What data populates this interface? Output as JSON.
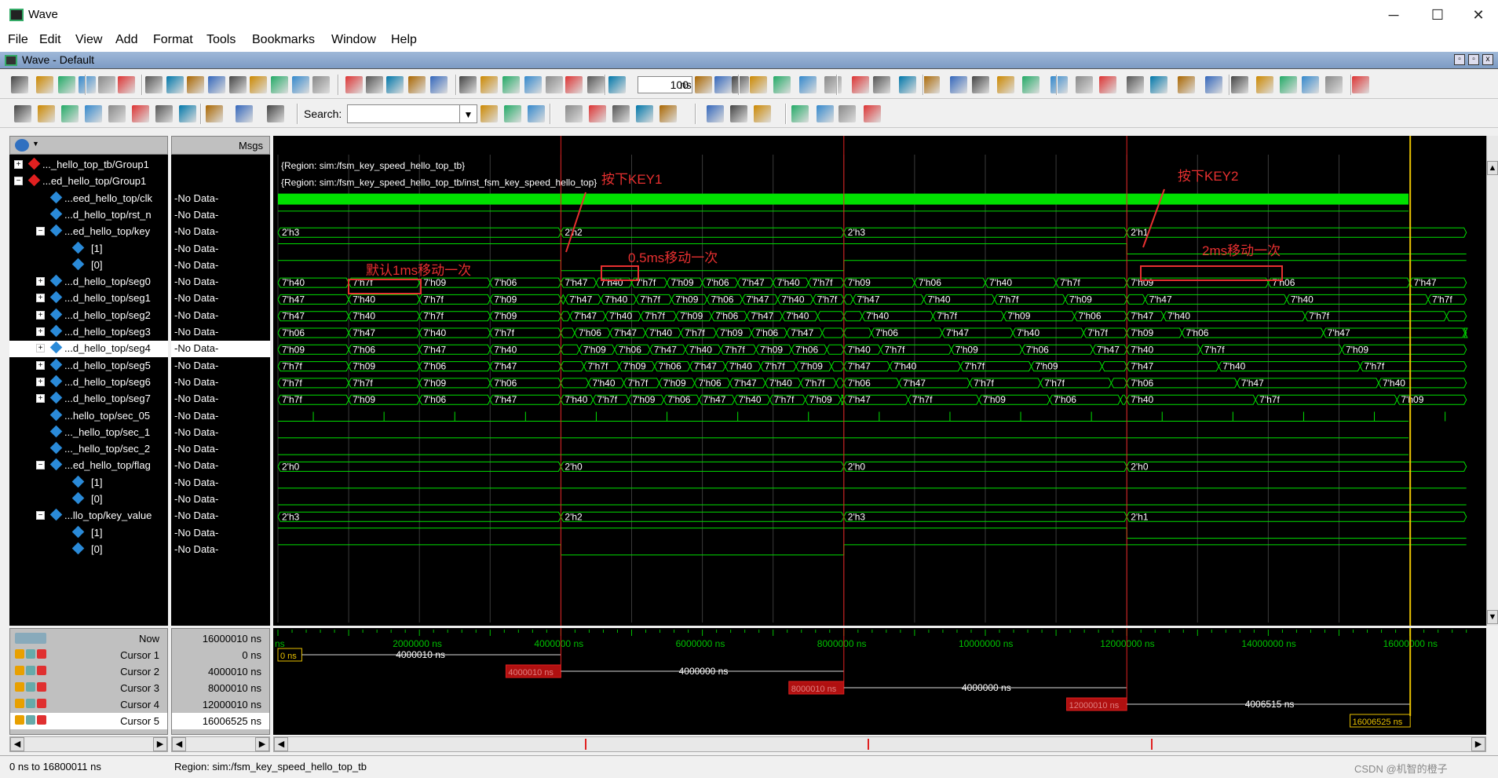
{
  "window": {
    "title": "Wave",
    "minimize": "─",
    "maximize": "☐",
    "close": "✕"
  },
  "menu": [
    "File",
    "Edit",
    "View",
    "Add",
    "Format",
    "Tools",
    "Bookmarks",
    "Window",
    "Help"
  ],
  "pane": {
    "title": "Wave - Default"
  },
  "toolbar": {
    "zoom_value": "100",
    "zoom_unit": "ns",
    "search_label": "Search:",
    "search_value": ""
  },
  "headers": {
    "values": "Msgs"
  },
  "signals": [
    {
      "name": "..._hello_top_tb/Group1",
      "value": "",
      "level": 0,
      "exp": "+",
      "color": "#e02020"
    },
    {
      "name": "...ed_hello_top/Group1",
      "value": "",
      "level": 0,
      "exp": "−",
      "color": "#e02020"
    },
    {
      "name": "...eed_hello_top/clk",
      "value": "-No Data-",
      "level": 1,
      "exp": "",
      "color": "#2a8ad8"
    },
    {
      "name": "...d_hello_top/rst_n",
      "value": "-No Data-",
      "level": 1,
      "exp": "",
      "color": "#2a8ad8"
    },
    {
      "name": "...ed_hello_top/key",
      "value": "-No Data-",
      "level": 1,
      "exp": "−",
      "color": "#2a8ad8"
    },
    {
      "name": "[1]",
      "value": "-No Data-",
      "level": 2,
      "exp": "",
      "color": "#2a8ad8"
    },
    {
      "name": "[0]",
      "value": "-No Data-",
      "level": 2,
      "exp": "",
      "color": "#2a8ad8"
    },
    {
      "name": "...d_hello_top/seg0",
      "value": "-No Data-",
      "level": 1,
      "exp": "+",
      "color": "#2a8ad8"
    },
    {
      "name": "...d_hello_top/seg1",
      "value": "-No Data-",
      "level": 1,
      "exp": "+",
      "color": "#2a8ad8"
    },
    {
      "name": "...d_hello_top/seg2",
      "value": "-No Data-",
      "level": 1,
      "exp": "+",
      "color": "#2a8ad8"
    },
    {
      "name": "...d_hello_top/seg3",
      "value": "-No Data-",
      "level": 1,
      "exp": "+",
      "color": "#2a8ad8"
    },
    {
      "name": "...d_hello_top/seg4",
      "value": "-No Data-",
      "level": 1,
      "exp": "+",
      "color": "#2a8ad8",
      "selected": true
    },
    {
      "name": "...d_hello_top/seg5",
      "value": "-No Data-",
      "level": 1,
      "exp": "+",
      "color": "#2a8ad8"
    },
    {
      "name": "...d_hello_top/seg6",
      "value": "-No Data-",
      "level": 1,
      "exp": "+",
      "color": "#2a8ad8"
    },
    {
      "name": "...d_hello_top/seg7",
      "value": "-No Data-",
      "level": 1,
      "exp": "+",
      "color": "#2a8ad8"
    },
    {
      "name": "...hello_top/sec_05",
      "value": "-No Data-",
      "level": 1,
      "exp": "",
      "color": "#2a8ad8"
    },
    {
      "name": "..._hello_top/sec_1",
      "value": "-No Data-",
      "level": 1,
      "exp": "",
      "color": "#2a8ad8"
    },
    {
      "name": "..._hello_top/sec_2",
      "value": "-No Data-",
      "level": 1,
      "exp": "",
      "color": "#2a8ad8"
    },
    {
      "name": "...ed_hello_top/flag",
      "value": "-No Data-",
      "level": 1,
      "exp": "−",
      "color": "#2a8ad8"
    },
    {
      "name": "[1]",
      "value": "-No Data-",
      "level": 2,
      "exp": "",
      "color": "#2a8ad8"
    },
    {
      "name": "[0]",
      "value": "-No Data-",
      "level": 2,
      "exp": "",
      "color": "#2a8ad8"
    },
    {
      "name": "...llo_top/key_value",
      "value": "-No Data-",
      "level": 1,
      "exp": "−",
      "color": "#2a8ad8"
    },
    {
      "name": "[1]",
      "value": "-No Data-",
      "level": 2,
      "exp": "",
      "color": "#2a8ad8"
    },
    {
      "name": "[0]",
      "value": "-No Data-",
      "level": 2,
      "exp": "",
      "color": "#2a8ad8"
    }
  ],
  "region_lines": [
    "{Region: sim:/fsm_key_speed_hello_top_tb}",
    "{Region: sim:/fsm_key_speed_hello_top_tb/inst_fsm_key_speed_hello_top}"
  ],
  "waves": {
    "key": [
      "2'h3",
      "2'h2",
      "2'h3",
      "2'h1"
    ],
    "seg": [
      [
        "7'h40",
        "7'h7f",
        "7'h09",
        "7'h06",
        "7'h47",
        "7'h40",
        "7'h7f",
        "7'h09",
        "7'h06",
        "7'h47",
        "7'h40",
        "7'h7f",
        "7'h09",
        "7'h06"
      ],
      [
        "7'h47",
        "7'h40",
        "7'h7f",
        "7'h09",
        "7'h06",
        "7'h47",
        "7'h40",
        "7'h7f",
        "7'h09",
        "7'h06",
        "7'h47",
        "7'h40",
        "7'h7f",
        "7'h09"
      ],
      [
        "7'h47",
        "7'h40",
        "7'h7f",
        "7'h09",
        "7'h06",
        "7'h47",
        "7'h40",
        "7'h7f",
        "7'h09",
        "7'h06",
        "7'h47",
        "7'h40",
        "7'h7f"
      ],
      [
        "7'h06",
        "7'h47",
        "7'h40",
        "7'h7f",
        "7'h09",
        "7'h06",
        "7'h47",
        "7'h40",
        "7'h7f",
        "7'h09",
        "7'h06",
        "7'h47",
        "7'h40",
        "7'h7f"
      ],
      [
        "7'h09",
        "7'h06",
        "7'h47",
        "7'h40",
        "7'h7f",
        "7'h09",
        "7'h06",
        "7'h47",
        "7'h40",
        "7'h7f",
        "7'h09",
        "7'h06",
        "7'h47",
        "7'h40",
        "7'h7f"
      ],
      [
        "7'h7f",
        "7'h09",
        "7'h06",
        "7'h47",
        "7'h40",
        "7'h7f",
        "7'h09",
        "7'h06",
        "7'h47",
        "7'h40",
        "7'h7f",
        "7'h09",
        "7'h06",
        "7'h47",
        "7'h40"
      ],
      [
        "7'h7f",
        "7'h7f",
        "7'h09",
        "7'h06",
        "7'h47",
        "7'h40",
        "7'h7f",
        "7'h09",
        "7'h06",
        "7'h47",
        "7'h40",
        "7'h7f",
        "7'h09",
        "7'h06",
        "7'h47"
      ],
      [
        "7'h7f",
        "7'h09",
        "7'h06",
        "7'h47",
        "7'h40",
        "7'h7f",
        "7'h09",
        "7'h06",
        "7'h47",
        "7'h40",
        "7'h7f",
        "7'h09",
        "7'h06",
        "7'h47"
      ]
    ],
    "flag": [
      "2'h0",
      "2'h0",
      "2'h0",
      "2'h0"
    ],
    "key_value": [
      "2'h3",
      "2'h2",
      "2'h3",
      "2'h1"
    ]
  },
  "annotations": {
    "key1": "按下KEY1",
    "key2": "按下KEY2",
    "default": "默认1ms移动一次",
    "half": "0.5ms移动一次",
    "two": "2ms移动一次"
  },
  "timeline": {
    "ticks": [
      "ns",
      "2000000 ns",
      "4000000 ns",
      "6000000 ns",
      "8000000 ns",
      "10000000 ns",
      "12000000 ns",
      "14000000 ns",
      "16000000 ns"
    ],
    "now_label": "Now",
    "now_value": "16000010 ns"
  },
  "cursors": [
    {
      "name": "Cursor 1",
      "value": "0 ns",
      "box": "0 ns",
      "delta": "4000010 ns"
    },
    {
      "name": "Cursor 2",
      "value": "4000010 ns",
      "box": "4000010 ns",
      "delta": "4000000 ns"
    },
    {
      "name": "Cursor 3",
      "value": "8000010 ns",
      "box": "8000010 ns",
      "delta": "4000000 ns"
    },
    {
      "name": "Cursor 4",
      "value": "12000010 ns",
      "box": "12000010 ns",
      "delta": "4006515 ns"
    },
    {
      "name": "Cursor 5",
      "value": "16006525 ns",
      "box": "16006525 ns",
      "delta": ""
    }
  ],
  "status": {
    "range": "0 ns to 16800011 ns",
    "region": "Region: sim:/fsm_key_speed_hello_top_tb",
    "watermark": "CSDN @机智的橙子"
  },
  "colors": {
    "wave": "#00e000",
    "cursor": "#e02020",
    "active_cursor": "#e8c000",
    "bus_text": "#ffffff"
  }
}
